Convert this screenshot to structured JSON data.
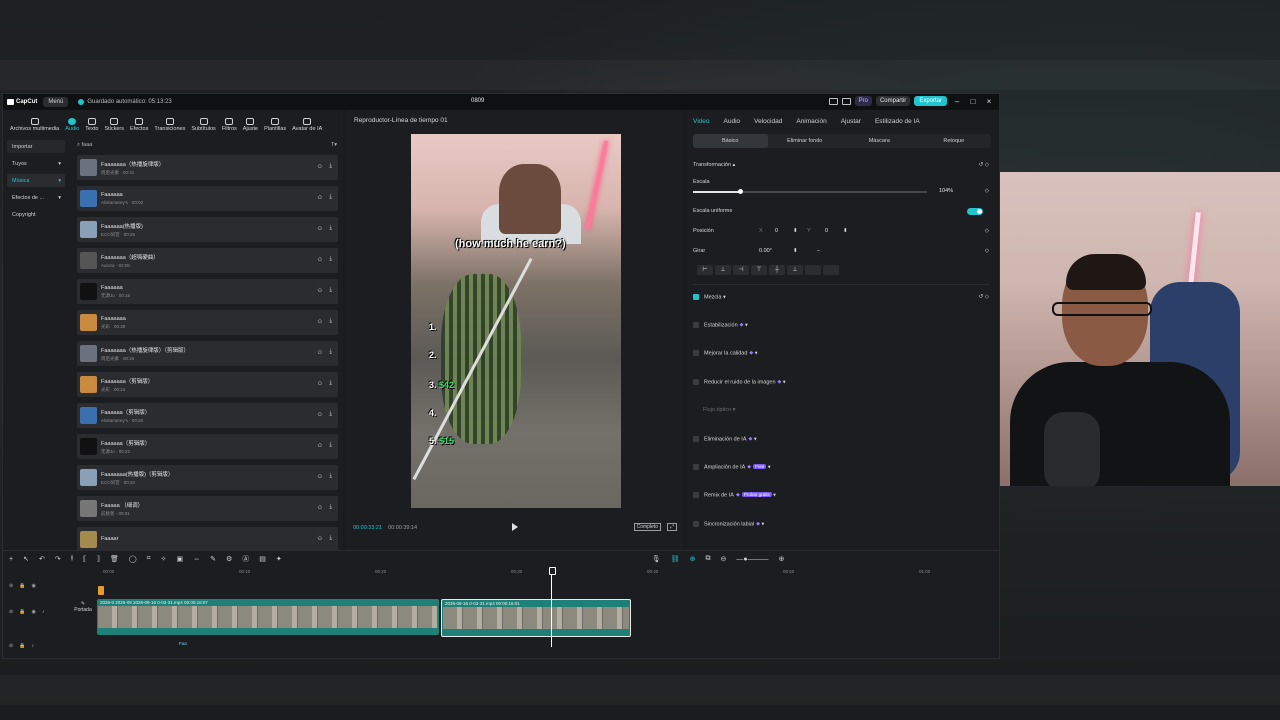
{
  "app": {
    "brand": "CapCut",
    "menu_label": "Menú",
    "autosave": "Guardado automático: 05:13:23",
    "project_name": "0809",
    "pro_label": "Pro",
    "share_label": "Compartir",
    "export_label": "Exportar",
    "accent_color": "#21c3cc"
  },
  "toolbar_tabs": [
    {
      "label": "Archivos multimedia",
      "icon": "media-icon"
    },
    {
      "label": "Audio",
      "icon": "audio-icon"
    },
    {
      "label": "Texto",
      "icon": "text-icon"
    },
    {
      "label": "Stickers",
      "icon": "sticker-icon"
    },
    {
      "label": "Efectos",
      "icon": "effects-icon"
    },
    {
      "label": "Transiciones",
      "icon": "transitions-icon"
    },
    {
      "label": "Subtítulos",
      "icon": "subtitles-icon"
    },
    {
      "label": "Filtros",
      "icon": "filters-icon"
    },
    {
      "label": "Ajuste",
      "icon": "adjust-icon"
    },
    {
      "label": "Plantillas",
      "icon": "templates-icon"
    },
    {
      "label": "Avatar de IA",
      "icon": "ai-avatar-icon"
    }
  ],
  "categories": [
    "Importar",
    "Tuyos",
    "Música",
    "Efectos de ...",
    "Copyright"
  ],
  "search": {
    "value": "faaa",
    "filter_label": "T"
  },
  "tracks": [
    {
      "name": "Faaaaaaa（热播旋律版）",
      "sub": "周后光素 · 00:31"
    },
    {
      "name": "Faaaaaa",
      "sub": "Alokamerey's · 00:02"
    },
    {
      "name": "Faaaaaa(热播版)",
      "sub": "ECO同音 · 00:25"
    },
    {
      "name": "Faaaaaaa（超嗨硬曲）",
      "sub": "Aurora · 02:08"
    },
    {
      "name": "Faaaaaa",
      "sub": "无源Jo · 00:15"
    },
    {
      "name": "Faaaaaaa",
      "sub": "光彩 · 00:30"
    },
    {
      "name": "Faaaaaaa（热播旋律版）（剪辑版）",
      "sub": "周后光素 · 00:25"
    },
    {
      "name": "Faaaaaaa（剪辑版）",
      "sub": "光彩 · 00:24"
    },
    {
      "name": "Faaaaaa（剪辑版）",
      "sub": "Alokamerey's · 00:20"
    },
    {
      "name": "Faaaaaa（剪辑版）",
      "sub": "无源Jo · 00:22"
    },
    {
      "name": "Faaaaaaa(热播版)（剪辑版）",
      "sub": "ECO同音 · 00:20"
    },
    {
      "name": "Faaaaa （细调）",
      "sub": "前桃爸 · 00:31"
    },
    {
      "name": "Faaaar",
      "sub": ""
    }
  ],
  "player": {
    "title": "Reproductor-Línea de tiempo 01",
    "caption": "(how much he earn?)",
    "ranks": [
      {
        "num": "1.",
        "value": ""
      },
      {
        "num": "2.",
        "value": ""
      },
      {
        "num": "3.",
        "value": "$42"
      },
      {
        "num": "4.",
        "value": ""
      },
      {
        "num": "5.",
        "value": "$15"
      }
    ],
    "current_time": "00:00:33:21",
    "total_time": "00:00:39:14",
    "ratio_label": "Completo"
  },
  "inspector": {
    "tabs": [
      "Video",
      "Audio",
      "Velocidad",
      "Animación",
      "Ajustar",
      "Estilizado de IA"
    ],
    "subtabs": [
      "Básico",
      "Eliminar fondo",
      "Máscara",
      "Retoque"
    ],
    "transform_title": "Transformación",
    "scale_label": "Escala",
    "scale_value": "104%",
    "scale_fraction": 0.2,
    "uniform_label": "Escala uniforme",
    "position_label": "Posición",
    "pos_x_label": "X",
    "pos_x": "0",
    "pos_y_label": "Y",
    "pos_y": "0",
    "rotate_label": "Girar",
    "rotate_value": "0.00°",
    "blend_label": "Mezcla",
    "options": [
      {
        "label": "Estabilización",
        "badge": ""
      },
      {
        "label": "Mejorar la calidad",
        "badge": ""
      },
      {
        "label": "Reducir el ruido de la imagen",
        "badge": ""
      },
      {
        "label": "Eliminación de IA",
        "badge": ""
      },
      {
        "label": "Ampliación de IA",
        "badge": "Free"
      },
      {
        "label": "Remix de IA",
        "badge": "Probar gratis"
      },
      {
        "label": "Sincronización labial",
        "badge": ""
      }
    ],
    "flujo_label": "Flujo óptico"
  },
  "timeline": {
    "ruler": [
      "00:00",
      "00:10",
      "00:20",
      "00:30",
      "00:40",
      "00:50",
      "01:00"
    ],
    "cover_label": "Portada",
    "clip_a": "2026-0  2026-09  2026-09-16  0-03-31.mp4  00:00:18:07",
    "clip_b": "2026-09-16  0-03-31.mp4  00:00:16:01",
    "audio_label": "Faa"
  }
}
